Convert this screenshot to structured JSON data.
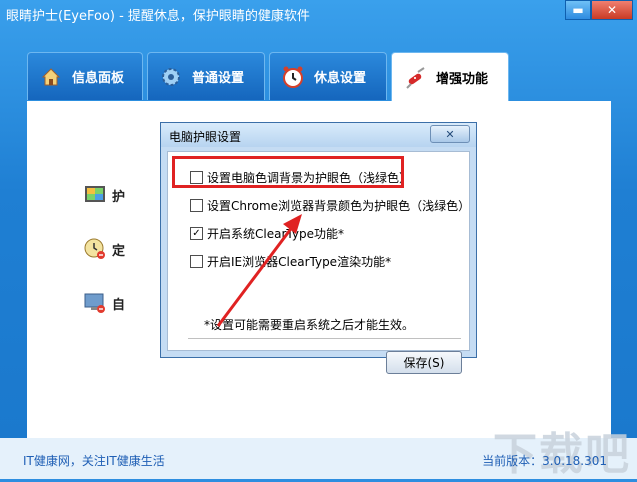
{
  "window": {
    "title": "眼睛护士(EyeFoo) - 提醒休息，保护眼睛的健康软件",
    "min_label": "▬",
    "close_label": "✕"
  },
  "tabs": [
    {
      "label": "信息面板",
      "icon": "house-icon"
    },
    {
      "label": "普通设置",
      "icon": "gear-icon"
    },
    {
      "label": "休息设置",
      "icon": "alarm-clock-icon"
    },
    {
      "label": "增强功能",
      "icon": "swiss-knife-icon"
    }
  ],
  "panel": {
    "rows": [
      {
        "label": "护",
        "icon": "display-color-icon"
      },
      {
        "label": "定",
        "icon": "clock-icon"
      },
      {
        "label": "自",
        "icon": "monitor-icon"
      }
    ]
  },
  "dialog": {
    "title": "电脑护眼设置",
    "close_label": "✕",
    "options": [
      {
        "label": "设置电脑色调背景为护眼色（浅绿色）",
        "checked": false
      },
      {
        "label": "设置Chrome浏览器背景颜色为护眼色（浅绿色）",
        "checked": false
      },
      {
        "label": "开启系统ClearType功能*",
        "checked": true
      },
      {
        "label": "开启IE浏览器ClearType渲染功能*",
        "checked": false
      }
    ],
    "note": "*设置可能需要重启系统之后才能生效。",
    "save_label": "保存(S)"
  },
  "status": {
    "left": "IT健康网，关注IT健康生活",
    "right": "当前版本：3.0.18.301"
  },
  "watermark": "下载吧",
  "colors": {
    "accent": "#1f7fd3",
    "highlight": "#e02222"
  }
}
